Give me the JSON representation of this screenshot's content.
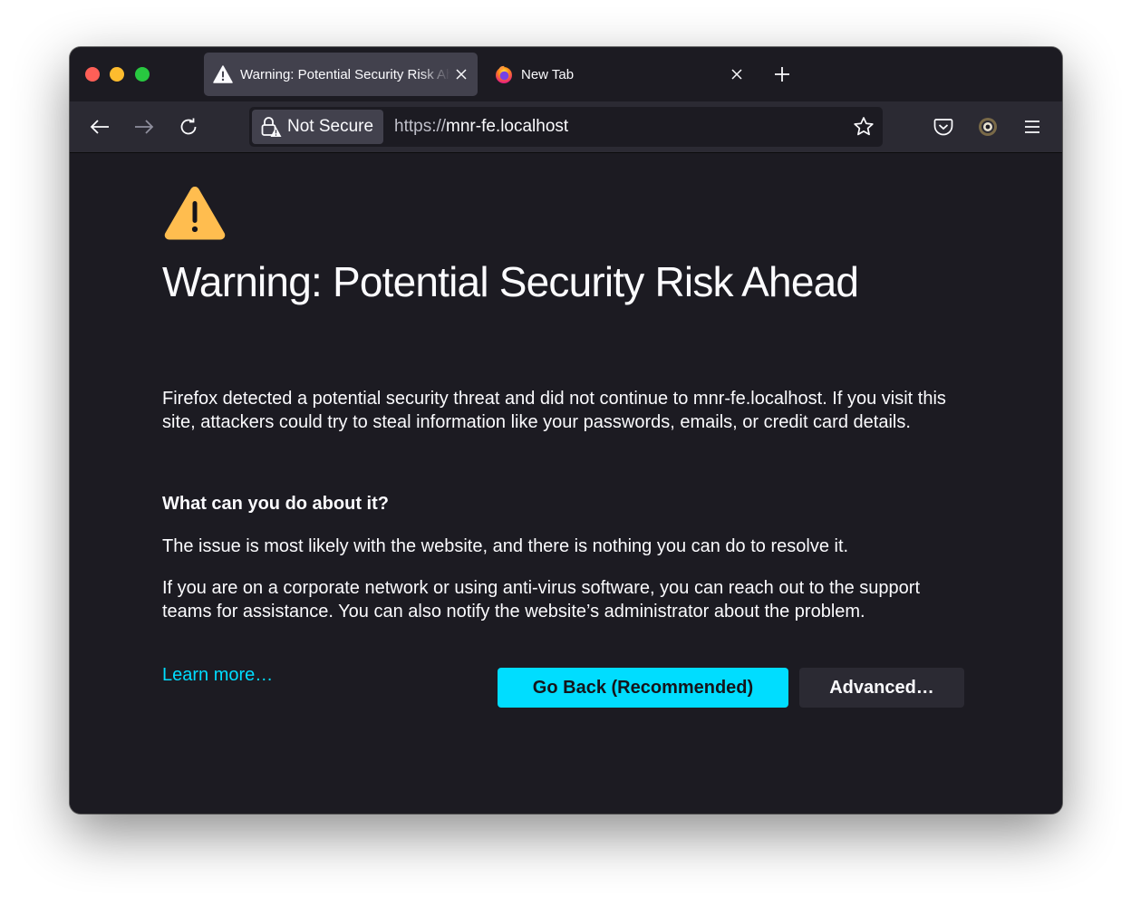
{
  "tabs": [
    {
      "title": "Warning: Potential Security Risk Ahead",
      "icon": "warning-icon",
      "active": true
    },
    {
      "title": "New Tab",
      "icon": "firefox-logo-icon",
      "active": false
    }
  ],
  "urlbar": {
    "identity_label": "Not Secure",
    "url_scheme": "https://",
    "url_host": "mnr-fe.localhost"
  },
  "page": {
    "title": "Warning: Potential Security Risk Ahead",
    "intro": "Firefox detected a potential security threat and did not continue to mnr-fe.localhost. If you visit this site, attackers could try to steal information like your passwords, emails, or credit card details.",
    "subheading": "What can you do about it?",
    "para2": "The issue is most likely with the website, and there is nothing you can do to resolve it.",
    "para3": "If you are on a corporate network or using anti-virus software, you can reach out to the support teams for assistance. You can also notify the website’s administrator about the problem.",
    "learn_more": "Learn more…",
    "go_back_label": "Go Back (Recommended)",
    "advanced_label": "Advanced…"
  },
  "colors": {
    "window_bg": "#1c1b22",
    "toolbar_bg": "#2b2a33",
    "accent": "#00ddff",
    "warning": "#ffbd4f"
  }
}
